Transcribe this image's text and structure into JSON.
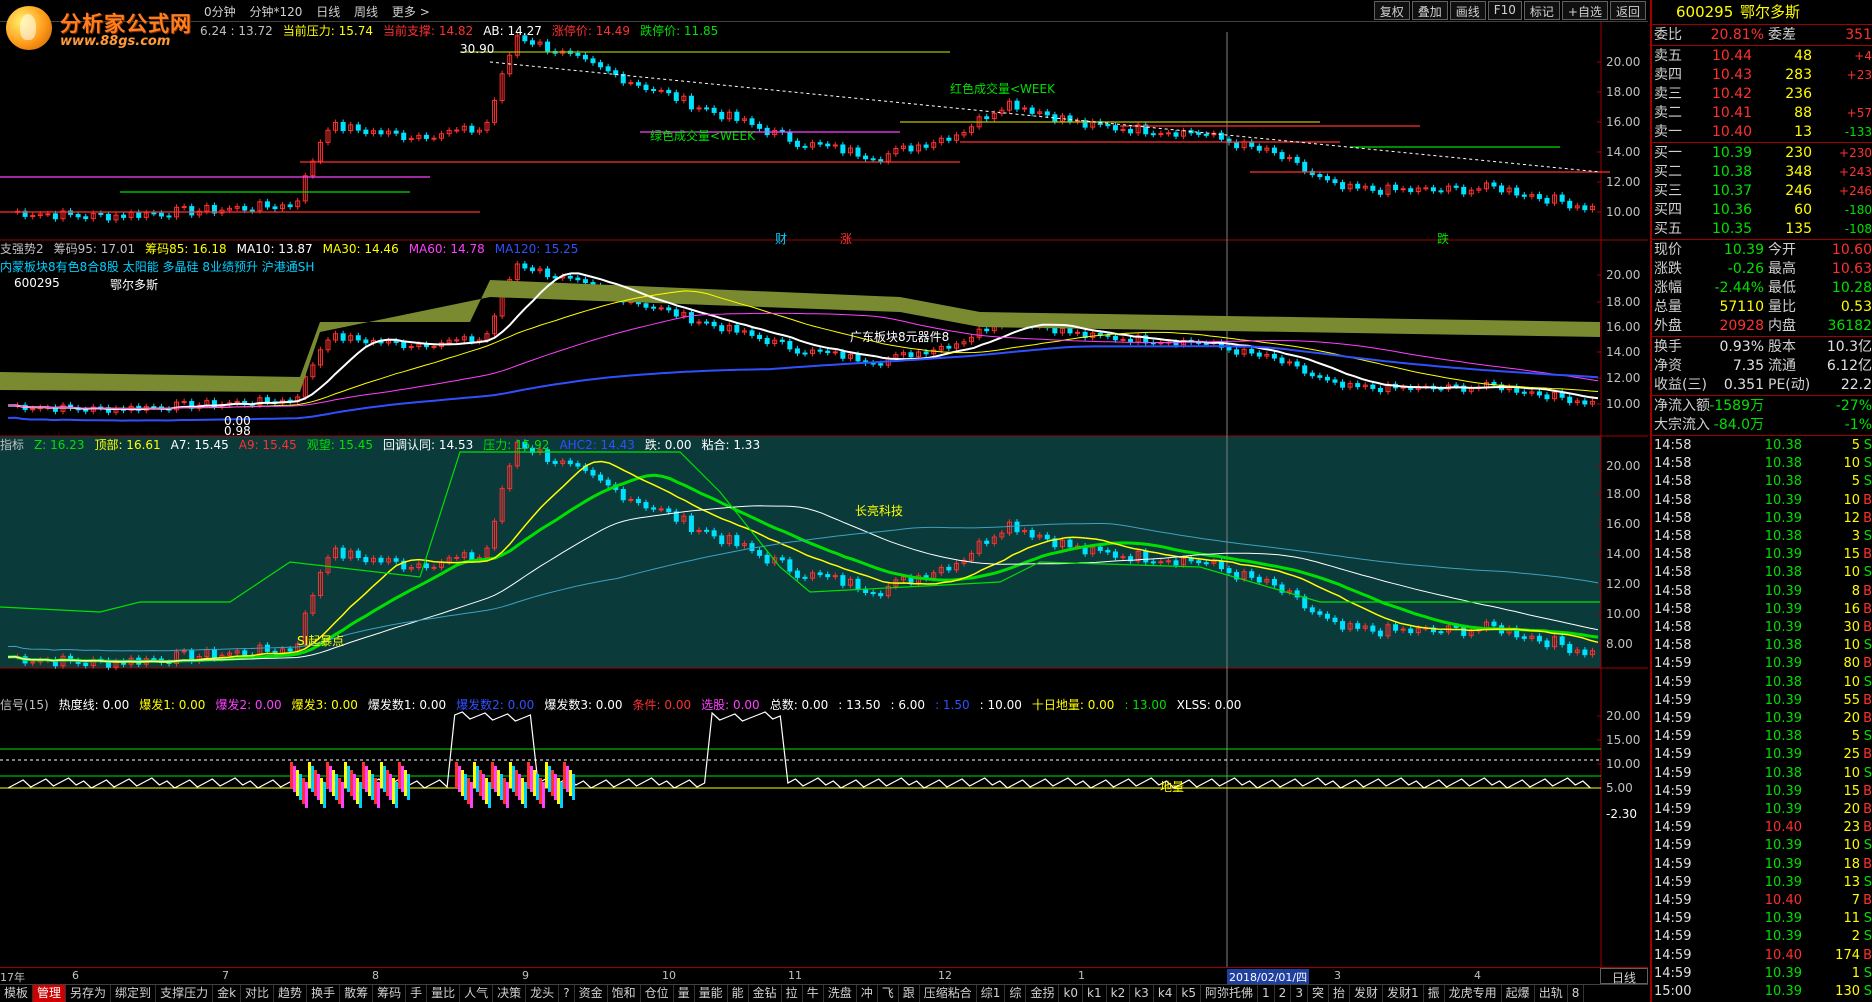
{
  "logo": {
    "name": "分析家公式网",
    "url": "www.88gs.com"
  },
  "periods": [
    "0分钟",
    "分钟*120",
    "日线",
    "周线",
    "更多 >"
  ],
  "toolbar_buttons": [
    "复权",
    "叠加",
    "画线",
    "F10",
    "标记",
    "+自选",
    "返回"
  ],
  "panel1": {
    "header": [
      {
        "t": "6.24 : 13.72",
        "c": "#c0c0c0"
      },
      {
        "t": "当前压力: 15.74",
        "c": "#ffff00"
      },
      {
        "t": "当前支撑: 14.82",
        "c": "#ff3030"
      },
      {
        "t": "AB: 14.27",
        "c": "#ffffff"
      },
      {
        "t": "涨停价: 14.49",
        "c": "#ff3030"
      },
      {
        "t": "跌停价: 11.85",
        "c": "#00e000"
      }
    ],
    "axis": [
      "20.00",
      "18.00",
      "16.00",
      "14.00",
      "12.00",
      "10.00"
    ],
    "annotations": [
      {
        "t": "30.90",
        "c": "#ffffff"
      },
      {
        "t": "红色成交量<WEEK",
        "c": "#00e000"
      },
      {
        "t": "绿色成交量<WEEK",
        "c": "#00e000"
      },
      {
        "t": "财",
        "c": "#00d0ff"
      },
      {
        "t": "涨",
        "c": "#ff3030"
      },
      {
        "t": "跌",
        "c": "#00e000"
      }
    ]
  },
  "panel2": {
    "header": [
      {
        "t": "支强势2",
        "c": "#c0c0c0"
      },
      {
        "t": "筹码95: 17.01",
        "c": "#c0c0c0"
      },
      {
        "t": "筹码85: 16.18",
        "c": "#ffff00"
      },
      {
        "t": "MA10: 13.87",
        "c": "#ffffff"
      },
      {
        "t": "MA30: 14.46",
        "c": "#ffff00"
      },
      {
        "t": "MA60: 14.78",
        "c": "#ff40ff"
      },
      {
        "t": "MA120: 15.25",
        "c": "#3050ff"
      }
    ],
    "line2": "内蒙板块8有色8合8股 太阳能 多晶硅 8业绩预升 沪港通SH",
    "code": "600295",
    "name": "鄂尔多斯",
    "axis": [
      "20.00",
      "18.00",
      "16.00",
      "14.00",
      "12.00",
      "10.00"
    ],
    "annotations": [
      {
        "t": "0.00",
        "c": "#ffffff"
      },
      {
        "t": "0.98",
        "c": "#ffffff"
      },
      {
        "t": "广东板块8元器件8",
        "c": "#ffffff"
      }
    ]
  },
  "panel3": {
    "header": [
      {
        "t": "指标",
        "c": "#c0c0c0"
      },
      {
        "t": "Z: 16.23",
        "c": "#00e000"
      },
      {
        "t": "顶部: 16.61",
        "c": "#ffff00"
      },
      {
        "t": "A7: 15.45",
        "c": "#ffffff"
      },
      {
        "t": "A9: 15.45",
        "c": "#ff3030"
      },
      {
        "t": "观望: 15.45",
        "c": "#00e000"
      },
      {
        "t": "回调认同: 14.53",
        "c": "#ffffff"
      },
      {
        "t": "压力: 15.92",
        "c": "#00e000"
      },
      {
        "t": "AHC2: 14.43",
        "c": "#3050ff"
      },
      {
        "t": "跌: 0.00",
        "c": "#ffffff"
      },
      {
        "t": "粘合: 1.33",
        "c": "#ffffff"
      }
    ],
    "axis": [
      "20.00",
      "18.00",
      "16.00",
      "14.00",
      "12.00",
      "10.00",
      "8.00"
    ],
    "annotations": [
      {
        "t": "SI起暴点",
        "c": "#ffff00"
      },
      {
        "t": "长亮科技",
        "c": "#ffff00"
      }
    ]
  },
  "panel4": {
    "header": [
      {
        "t": "信号(15)",
        "c": "#c0c0c0"
      },
      {
        "t": "热度线: 0.00",
        "c": "#ffffff"
      },
      {
        "t": "爆发1: 0.00",
        "c": "#ffff00"
      },
      {
        "t": "爆发2: 0.00",
        "c": "#ff40ff"
      },
      {
        "t": "爆发3: 0.00",
        "c": "#ffff00"
      },
      {
        "t": "爆发数1: 0.00",
        "c": "#ffffff"
      },
      {
        "t": "爆发数2: 0.00",
        "c": "#3050ff"
      },
      {
        "t": "爆发数3: 0.00",
        "c": "#ffffff"
      },
      {
        "t": "条件: 0.00",
        "c": "#ff3030"
      },
      {
        "t": "选股: 0.00",
        "c": "#ff40ff"
      },
      {
        "t": "总数: 0.00",
        "c": "#ffffff"
      },
      {
        "t": ": 13.50",
        "c": "#ffffff"
      },
      {
        "t": ": 6.00",
        "c": "#ffffff"
      },
      {
        "t": ": 1.50",
        "c": "#3050ff"
      },
      {
        "t": ": 10.00",
        "c": "#ffffff"
      },
      {
        "t": "十日地量: 0.00",
        "c": "#ffff00"
      },
      {
        "t": ": 13.00",
        "c": "#00e000"
      },
      {
        "t": "XLSS: 0.00",
        "c": "#ffffff"
      }
    ],
    "axis": [
      "20.00",
      "15.00",
      "10.00",
      "5.00"
    ],
    "readout": "-2.30",
    "annotations": [
      {
        "t": "地量",
        "c": "#ffff00"
      }
    ]
  },
  "datebar": [
    "17年",
    "6",
    "7",
    "8",
    "9",
    "10",
    "11",
    "12",
    "1",
    "2018/02/01/四",
    "3",
    "4"
  ],
  "bottom_tabs": [
    "模板",
    "管理",
    "另存为",
    "绑定到",
    "支撑压力",
    "金k",
    "对比",
    "趋势",
    "换手",
    "散筹",
    "筹码",
    "手",
    "量比",
    "人气",
    "决策",
    "龙头",
    "?",
    "资金",
    "饱和",
    "仓位",
    "量",
    "量能",
    "能",
    "金钻",
    "拉",
    "牛",
    "洗盘",
    "冲",
    "飞",
    "跟",
    "压缩粘合",
    "综1",
    "综",
    "金拐",
    "k0",
    "k1",
    "k2",
    "k3",
    "k4",
    "k5",
    "阿弥托佛",
    "1",
    "2",
    "3",
    "突",
    "抬",
    "发财",
    "发财1",
    "振",
    "龙虎专用",
    "起爆",
    "出轨",
    "8"
  ],
  "bottom_active": "管理",
  "side_tab": "日线",
  "quote": {
    "code": "600295",
    "name": "鄂尔多斯",
    "weibi": {
      "k": "委比",
      "v": "20.81%",
      "k2": "委差",
      "v2": "351"
    },
    "sell": [
      {
        "k": "卖五",
        "p": "10.44",
        "q": "48",
        "d": "+4"
      },
      {
        "k": "卖四",
        "p": "10.43",
        "q": "283",
        "d": "+23"
      },
      {
        "k": "卖三",
        "p": "10.42",
        "q": "236",
        "d": ""
      },
      {
        "k": "卖二",
        "p": "10.41",
        "q": "88",
        "d": "+57"
      },
      {
        "k": "卖一",
        "p": "10.40",
        "q": "13",
        "d": "-133"
      }
    ],
    "buy": [
      {
        "k": "买一",
        "p": "10.39",
        "q": "230",
        "d": "+230"
      },
      {
        "k": "买二",
        "p": "10.38",
        "q": "348",
        "d": "+243"
      },
      {
        "k": "买三",
        "p": "10.37",
        "q": "246",
        "d": "+246"
      },
      {
        "k": "买四",
        "p": "10.36",
        "q": "60",
        "d": "-180"
      },
      {
        "k": "买五",
        "p": "10.35",
        "q": "135",
        "d": "-108"
      }
    ],
    "stats": [
      {
        "k": "现价",
        "v": "10.39",
        "c": "#00e000",
        "k2": "今开",
        "v2": "10.60",
        "c2": "#ff3030"
      },
      {
        "k": "涨跌",
        "v": "-0.26",
        "c": "#00e000",
        "k2": "最高",
        "v2": "10.63",
        "c2": "#ff3030"
      },
      {
        "k": "涨幅",
        "v": "-2.44%",
        "c": "#00e000",
        "k2": "最低",
        "v2": "10.28",
        "c2": "#00e000"
      },
      {
        "k": "总量",
        "v": "57110",
        "c": "#ffff00",
        "k2": "量比",
        "v2": "0.53",
        "c2": "#ffff00"
      },
      {
        "k": "外盘",
        "v": "20928",
        "c": "#ff3030",
        "k2": "内盘",
        "v2": "36182",
        "c2": "#00e000"
      }
    ],
    "stats2": [
      {
        "k": "换手",
        "v": "0.93%",
        "k2": "股本",
        "v2": "10.3亿"
      },
      {
        "k": "净资",
        "v": "7.35",
        "k2": "流通",
        "v2": "6.12亿"
      },
      {
        "k": "收益(三)",
        "v": "0.351",
        "k2": "PE(动)",
        "v2": "22.2"
      }
    ],
    "flow": [
      {
        "k": "净流入额",
        "v": "-1589万",
        "v2": "-27%"
      },
      {
        "k": "大宗流入",
        "v": "-84.0万",
        "v2": "-1%"
      }
    ],
    "ticks": [
      {
        "t": "14:58",
        "p": "10.38",
        "q": "5",
        "s": "S"
      },
      {
        "t": "14:58",
        "p": "10.38",
        "q": "10",
        "s": "S"
      },
      {
        "t": "14:58",
        "p": "10.38",
        "q": "5",
        "s": "S"
      },
      {
        "t": "14:58",
        "p": "10.39",
        "q": "10",
        "s": "B"
      },
      {
        "t": "14:58",
        "p": "10.39",
        "q": "12",
        "s": "B"
      },
      {
        "t": "14:58",
        "p": "10.38",
        "q": "3",
        "s": "S"
      },
      {
        "t": "14:58",
        "p": "10.39",
        "q": "15",
        "s": "B"
      },
      {
        "t": "14:58",
        "p": "10.38",
        "q": "10",
        "s": "S"
      },
      {
        "t": "14:58",
        "p": "10.39",
        "q": "8",
        "s": "B"
      },
      {
        "t": "14:58",
        "p": "10.39",
        "q": "16",
        "s": "B"
      },
      {
        "t": "14:58",
        "p": "10.39",
        "q": "30",
        "s": "B"
      },
      {
        "t": "14:58",
        "p": "10.38",
        "q": "10",
        "s": "S"
      },
      {
        "t": "14:59",
        "p": "10.39",
        "q": "80",
        "s": "B"
      },
      {
        "t": "14:59",
        "p": "10.38",
        "q": "10",
        "s": "S"
      },
      {
        "t": "14:59",
        "p": "10.39",
        "q": "55",
        "s": "B"
      },
      {
        "t": "14:59",
        "p": "10.39",
        "q": "20",
        "s": "B"
      },
      {
        "t": "14:59",
        "p": "10.38",
        "q": "5",
        "s": "S"
      },
      {
        "t": "14:59",
        "p": "10.39",
        "q": "25",
        "s": "B"
      },
      {
        "t": "14:59",
        "p": "10.38",
        "q": "10",
        "s": "S"
      },
      {
        "t": "14:59",
        "p": "10.39",
        "q": "15",
        "s": "B"
      },
      {
        "t": "14:59",
        "p": "10.39",
        "q": "20",
        "s": "B"
      },
      {
        "t": "14:59",
        "p": "10.40",
        "q": "23",
        "s": "B"
      },
      {
        "t": "14:59",
        "p": "10.39",
        "q": "10",
        "s": "S"
      },
      {
        "t": "14:59",
        "p": "10.39",
        "q": "18",
        "s": "B"
      },
      {
        "t": "14:59",
        "p": "10.39",
        "q": "13",
        "s": "S"
      },
      {
        "t": "14:59",
        "p": "10.40",
        "q": "7",
        "s": "B"
      },
      {
        "t": "14:59",
        "p": "10.39",
        "q": "11",
        "s": "S"
      },
      {
        "t": "14:59",
        "p": "10.39",
        "q": "2",
        "s": "S"
      },
      {
        "t": "14:59",
        "p": "10.40",
        "q": "174",
        "s": "B"
      },
      {
        "t": "14:59",
        "p": "10.39",
        "q": "1",
        "s": "S"
      },
      {
        "t": "15:00",
        "p": "10.39",
        "q": "130",
        "s": "S"
      }
    ]
  },
  "colors": {
    "up": "#ff3030",
    "down": "#00e0ff",
    "bg3": "#0a3a3a"
  }
}
